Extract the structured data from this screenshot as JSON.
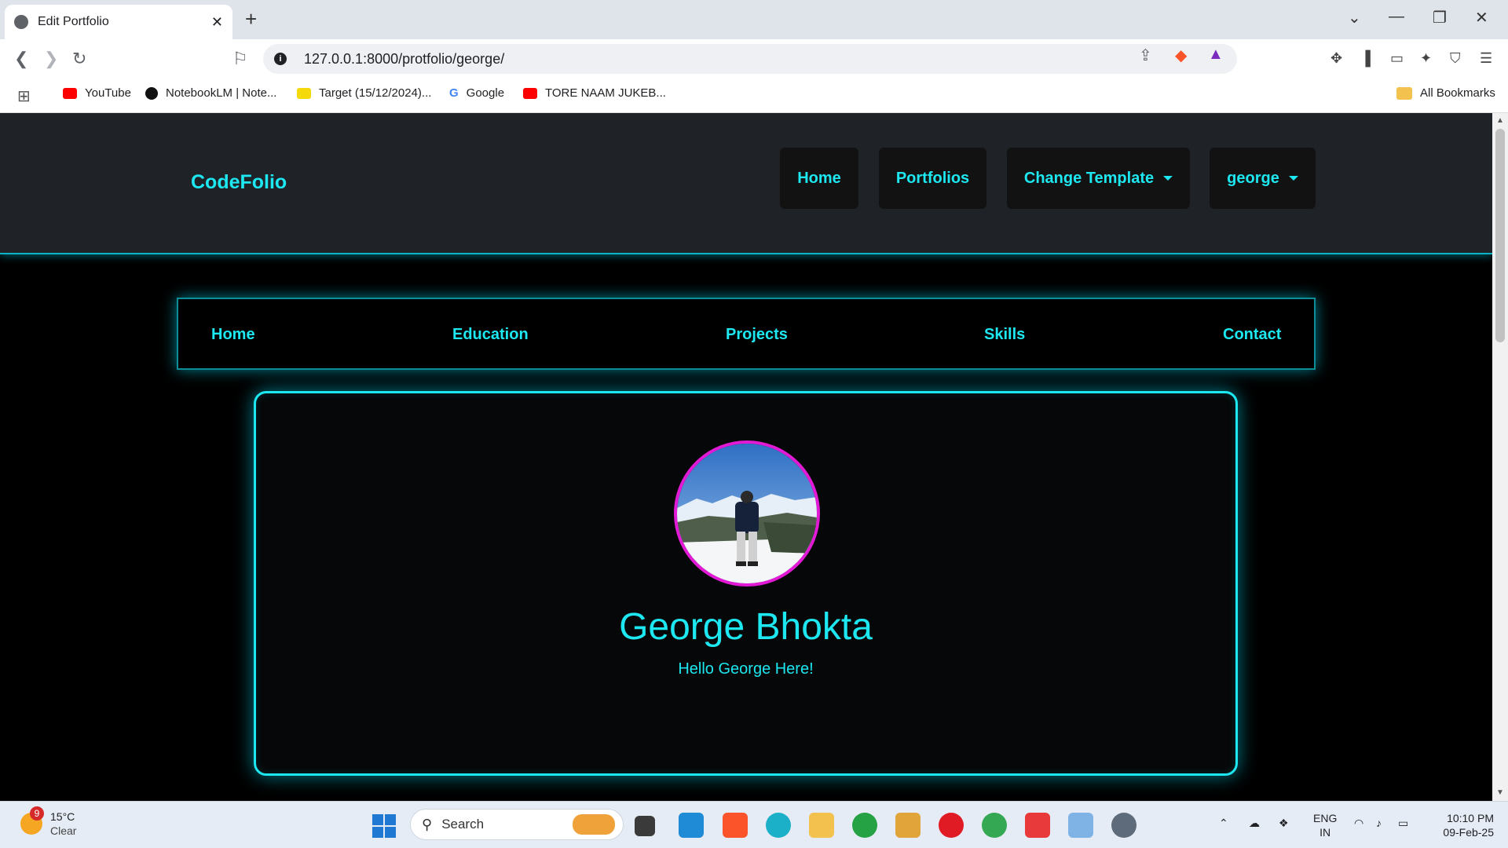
{
  "browser": {
    "tab_title": "Edit Portfolio",
    "url": "127.0.0.1:8000/protfolio/george/",
    "bookmarks": [
      {
        "label": "YouTube",
        "color": "#ff0000"
      },
      {
        "label": "NotebookLM | Note...",
        "color": "#111111"
      },
      {
        "label": "Target (15/12/2024)...",
        "color": "#f5d90a"
      },
      {
        "label": "Google",
        "color": "#4285f4"
      },
      {
        "label": "TORE NAAM JUKEB...",
        "color": "#ff0000"
      }
    ],
    "all_bookmarks": "All Bookmarks"
  },
  "site": {
    "brand": "CodeFolio",
    "header_nav": {
      "home": "Home",
      "portfolios": "Portfolios",
      "change_template": "Change Template",
      "user": "george"
    },
    "portfolio_nav": {
      "home": "Home",
      "education": "Education",
      "projects": "Projects",
      "skills": "Skills",
      "contact": "Contact"
    },
    "profile": {
      "name": "George Bhokta",
      "tagline": "Hello George Here!"
    },
    "accent_color": "#1de7f0",
    "avatar_border_color": "#e21ad6"
  },
  "taskbar": {
    "weather_badge": "9",
    "weather_temp": "15°C",
    "weather_cond": "Clear",
    "search_placeholder": "Search",
    "lang_top": "ENG",
    "lang_bottom": "IN",
    "time": "10:10 PM",
    "date": "09-Feb-25"
  }
}
